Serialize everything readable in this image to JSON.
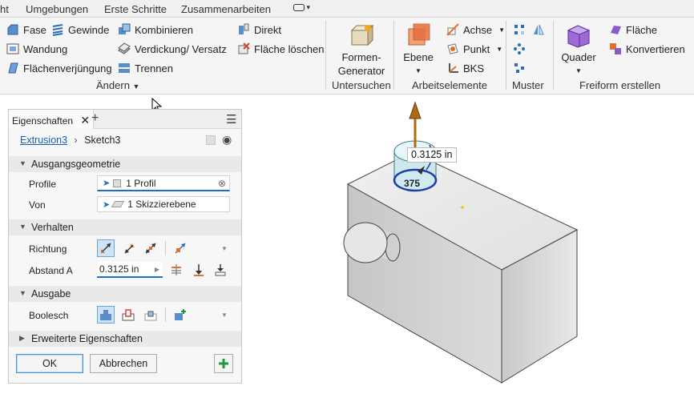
{
  "menu": {
    "items": [
      "ht",
      "Umgebungen",
      "Erste Schritte",
      "Zusammenarbeiten"
    ]
  },
  "ribbon": {
    "aendern": {
      "fase": "Fase",
      "gewinde": "Gewinde",
      "wandung": "Wandung",
      "flaechenverjuengung": "Flächenverjüngung",
      "kombinieren": "Kombinieren",
      "verdickung": "Verdickung/ Versatz",
      "trennen": "Trennen",
      "direkt": "Direkt",
      "flaeche_loeschen": "Fläche löschen",
      "label": "Ändern"
    },
    "untersuchen": {
      "formen_line1": "Formen-",
      "formen_line2": "Generator",
      "label": "Untersuchen"
    },
    "arbeitselemente": {
      "ebene": "Ebene",
      "achse": "Achse",
      "punkt": "Punkt",
      "bks": "BKS",
      "label": "Arbeitselemente"
    },
    "muster": {
      "label": "Muster"
    },
    "freiform": {
      "quader": "Quader",
      "flaeche": "Fläche",
      "konvertieren": "Konvertieren",
      "label": "Freiform erstellen"
    }
  },
  "panel": {
    "tab": "Eigenschaften",
    "breadcrumb": {
      "feature": "Extrusion3",
      "sketch": "Sketch3"
    },
    "sections": {
      "ausgangsgeometrie": "Ausgangsgeometrie",
      "verhalten": "Verhalten",
      "ausgabe": "Ausgabe",
      "erweitert": "Erweiterte Eigenschaften"
    },
    "rows": {
      "profile_label": "Profile",
      "profile_value": "1 Profil",
      "von_label": "Von",
      "von_value": "1 Skizzierebene",
      "richtung_label": "Richtung",
      "abstand_label": "Abstand A",
      "abstand_value": "0.3125 in",
      "boolesch_label": "Boolesch"
    },
    "buttons": {
      "ok": "OK",
      "abbrechen": "Abbrechen"
    }
  },
  "viewport": {
    "dim_input": "0.3125 in",
    "dim_value": "375"
  },
  "colors": {
    "accent": "#1e6fbf",
    "link": "#1a5fb4",
    "arrow": "#b06a10",
    "green_plus": "#1e9a3c"
  }
}
